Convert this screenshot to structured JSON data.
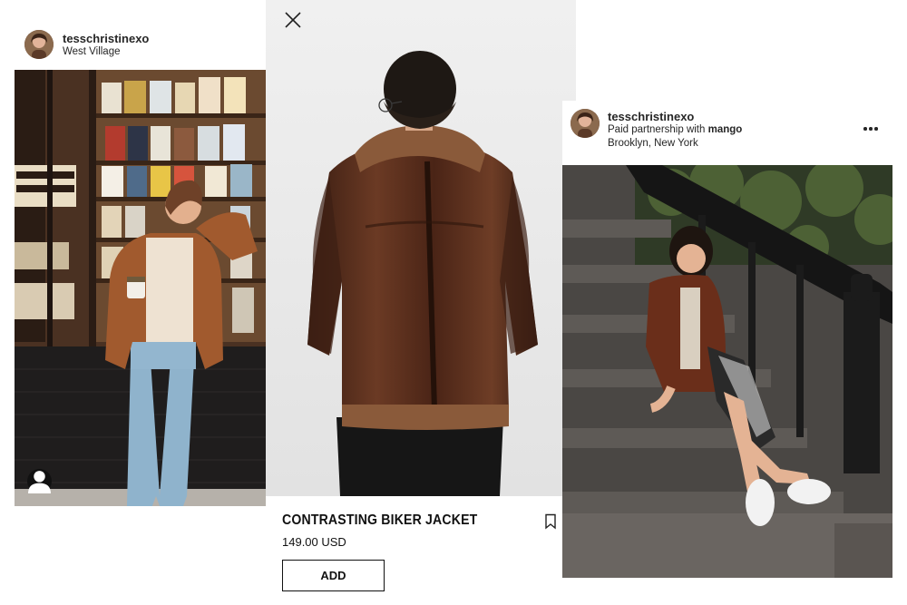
{
  "left_post": {
    "username": "tesschristinexo",
    "location": "West Village",
    "avatar_icon": "user-avatar",
    "tag_icon": "user-tag-icon"
  },
  "product": {
    "name": "CONTRASTING BIKER JACKET",
    "price": "149.00 USD",
    "add_label": "ADD",
    "close_icon": "close-icon",
    "bookmark_icon": "bookmark-icon"
  },
  "right_post": {
    "username": "tesschristinexo",
    "partnership_prefix": "Paid partnership with ",
    "partner": "mango",
    "location": "Brooklyn, New York",
    "more_icon": "more-options-icon"
  },
  "colors": {
    "text": "#262626",
    "jacket_brown": "#5a2f1d",
    "shearling": "#8a5a3a",
    "product_bg": "#ececec"
  }
}
